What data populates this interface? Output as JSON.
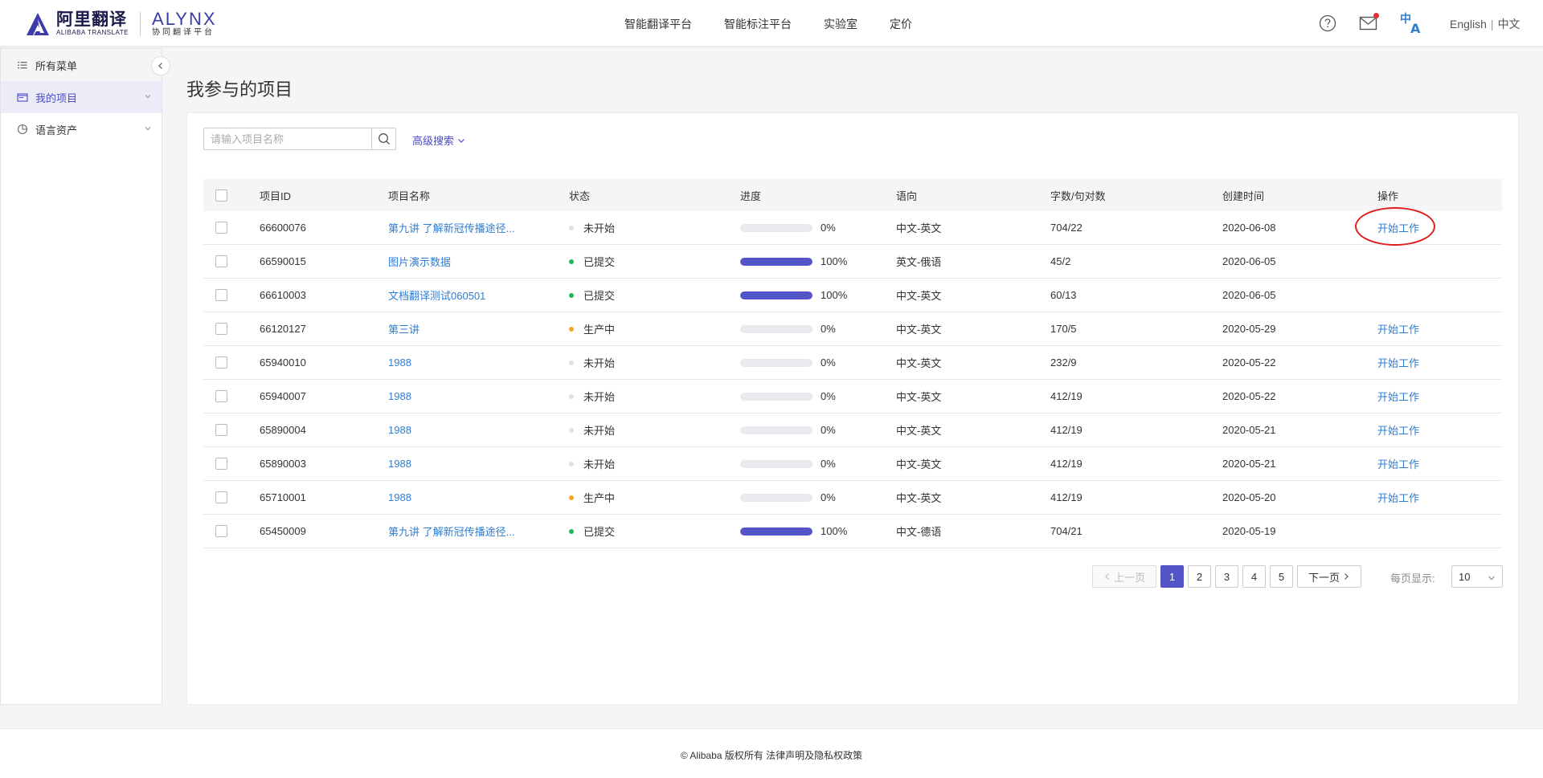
{
  "header": {
    "logo_cn": "阿里翻译",
    "logo_en": "ALIBABA TRANSLATE",
    "alynx_name": "ALYNX",
    "alynx_sub": "协同翻译平台",
    "nav": [
      "智能翻译平台",
      "智能标注平台",
      "实验室",
      "定价"
    ],
    "lang_en": "English",
    "lang_cn": "中文",
    "icons": [
      "help-icon",
      "mail-icon",
      "translate-icon"
    ]
  },
  "sidebar": {
    "items": [
      {
        "label": "所有菜单",
        "icon": "list-icon"
      },
      {
        "label": "我的项目",
        "icon": "folder-icon"
      },
      {
        "label": "语言资产",
        "icon": "pie-icon"
      }
    ]
  },
  "main": {
    "title": "我参与的项目",
    "search_placeholder": "请输入项目名称",
    "advanced_search": "高级搜索",
    "columns": [
      "项目ID",
      "项目名称",
      "状态",
      "进度",
      "语向",
      "字数/句对数",
      "创建时间",
      "操作"
    ],
    "rows": [
      {
        "id": "66600076",
        "name": "第九讲 了解新冠传播途径...",
        "status": "未开始",
        "status_color": "#e0e0e0",
        "progress": 0,
        "progress_text": "0%",
        "lang": "中文-英文",
        "count": "704/22",
        "date": "2020-06-08",
        "op": "开始工作"
      },
      {
        "id": "66590015",
        "name": "图片演示数据",
        "status": "已提交",
        "status_color": "#1fb85c",
        "progress": 100,
        "progress_text": "100%",
        "lang": "英文-俄语",
        "count": "45/2",
        "date": "2020-06-05",
        "op": ""
      },
      {
        "id": "66610003",
        "name": "文档翻译测试060501",
        "status": "已提交",
        "status_color": "#1fb85c",
        "progress": 100,
        "progress_text": "100%",
        "lang": "中文-英文",
        "count": "60/13",
        "date": "2020-06-05",
        "op": ""
      },
      {
        "id": "66120127",
        "name": "第三讲",
        "status": "生产中",
        "status_color": "#f5a623",
        "progress": 0,
        "progress_text": "0%",
        "lang": "中文-英文",
        "count": "170/5",
        "date": "2020-05-29",
        "op": "开始工作"
      },
      {
        "id": "65940010",
        "name": "1988",
        "status": "未开始",
        "status_color": "#e0e0e0",
        "progress": 0,
        "progress_text": "0%",
        "lang": "中文-英文",
        "count": "232/9",
        "date": "2020-05-22",
        "op": "开始工作"
      },
      {
        "id": "65940007",
        "name": "1988",
        "status": "未开始",
        "status_color": "#e0e0e0",
        "progress": 0,
        "progress_text": "0%",
        "lang": "中文-英文",
        "count": "412/19",
        "date": "2020-05-22",
        "op": "开始工作"
      },
      {
        "id": "65890004",
        "name": "1988",
        "status": "未开始",
        "status_color": "#e0e0e0",
        "progress": 0,
        "progress_text": "0%",
        "lang": "中文-英文",
        "count": "412/19",
        "date": "2020-05-21",
        "op": "开始工作"
      },
      {
        "id": "65890003",
        "name": "1988",
        "status": "未开始",
        "status_color": "#e0e0e0",
        "progress": 0,
        "progress_text": "0%",
        "lang": "中文-英文",
        "count": "412/19",
        "date": "2020-05-21",
        "op": "开始工作"
      },
      {
        "id": "65710001",
        "name": "1988",
        "status": "生产中",
        "status_color": "#f5a623",
        "progress": 0,
        "progress_text": "0%",
        "lang": "中文-英文",
        "count": "412/19",
        "date": "2020-05-20",
        "op": "开始工作"
      },
      {
        "id": "65450009",
        "name": "第九讲 了解新冠传播途径...",
        "status": "已提交",
        "status_color": "#1fb85c",
        "progress": 100,
        "progress_text": "100%",
        "lang": "中文-德语",
        "count": "704/21",
        "date": "2020-05-19",
        "op": ""
      }
    ]
  },
  "pagination": {
    "prev": "上一页",
    "pages": [
      "1",
      "2",
      "3",
      "4",
      "5"
    ],
    "current": "1",
    "next": "下一页",
    "per_page_label": "每页显示:",
    "per_page_value": "10"
  },
  "footer": {
    "text": "© Alibaba 版权所有 法律声明及隐私权政策"
  },
  "colors": {
    "accent": "#5454c9",
    "link": "#2f7dd1",
    "highlight": "#e01e1e"
  }
}
